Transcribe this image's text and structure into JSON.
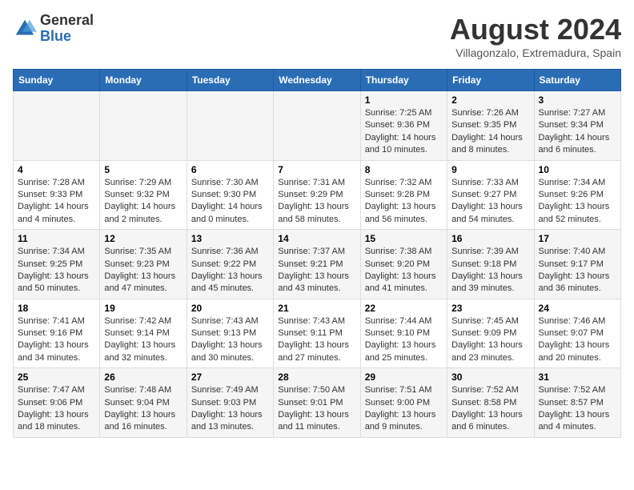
{
  "logo": {
    "general": "General",
    "blue": "Blue"
  },
  "title": "August 2024",
  "subtitle": "Villagonzalo, Extremadura, Spain",
  "days_of_week": [
    "Sunday",
    "Monday",
    "Tuesday",
    "Wednesday",
    "Thursday",
    "Friday",
    "Saturday"
  ],
  "weeks": [
    [
      {
        "day": "",
        "info": ""
      },
      {
        "day": "",
        "info": ""
      },
      {
        "day": "",
        "info": ""
      },
      {
        "day": "",
        "info": ""
      },
      {
        "day": "1",
        "info": "Sunrise: 7:25 AM\nSunset: 9:36 PM\nDaylight: 14 hours\nand 10 minutes."
      },
      {
        "day": "2",
        "info": "Sunrise: 7:26 AM\nSunset: 9:35 PM\nDaylight: 14 hours\nand 8 minutes."
      },
      {
        "day": "3",
        "info": "Sunrise: 7:27 AM\nSunset: 9:34 PM\nDaylight: 14 hours\nand 6 minutes."
      }
    ],
    [
      {
        "day": "4",
        "info": "Sunrise: 7:28 AM\nSunset: 9:33 PM\nDaylight: 14 hours\nand 4 minutes."
      },
      {
        "day": "5",
        "info": "Sunrise: 7:29 AM\nSunset: 9:32 PM\nDaylight: 14 hours\nand 2 minutes."
      },
      {
        "day": "6",
        "info": "Sunrise: 7:30 AM\nSunset: 9:30 PM\nDaylight: 14 hours\nand 0 minutes."
      },
      {
        "day": "7",
        "info": "Sunrise: 7:31 AM\nSunset: 9:29 PM\nDaylight: 13 hours\nand 58 minutes."
      },
      {
        "day": "8",
        "info": "Sunrise: 7:32 AM\nSunset: 9:28 PM\nDaylight: 13 hours\nand 56 minutes."
      },
      {
        "day": "9",
        "info": "Sunrise: 7:33 AM\nSunset: 9:27 PM\nDaylight: 13 hours\nand 54 minutes."
      },
      {
        "day": "10",
        "info": "Sunrise: 7:34 AM\nSunset: 9:26 PM\nDaylight: 13 hours\nand 52 minutes."
      }
    ],
    [
      {
        "day": "11",
        "info": "Sunrise: 7:34 AM\nSunset: 9:25 PM\nDaylight: 13 hours\nand 50 minutes."
      },
      {
        "day": "12",
        "info": "Sunrise: 7:35 AM\nSunset: 9:23 PM\nDaylight: 13 hours\nand 47 minutes."
      },
      {
        "day": "13",
        "info": "Sunrise: 7:36 AM\nSunset: 9:22 PM\nDaylight: 13 hours\nand 45 minutes."
      },
      {
        "day": "14",
        "info": "Sunrise: 7:37 AM\nSunset: 9:21 PM\nDaylight: 13 hours\nand 43 minutes."
      },
      {
        "day": "15",
        "info": "Sunrise: 7:38 AM\nSunset: 9:20 PM\nDaylight: 13 hours\nand 41 minutes."
      },
      {
        "day": "16",
        "info": "Sunrise: 7:39 AM\nSunset: 9:18 PM\nDaylight: 13 hours\nand 39 minutes."
      },
      {
        "day": "17",
        "info": "Sunrise: 7:40 AM\nSunset: 9:17 PM\nDaylight: 13 hours\nand 36 minutes."
      }
    ],
    [
      {
        "day": "18",
        "info": "Sunrise: 7:41 AM\nSunset: 9:16 PM\nDaylight: 13 hours\nand 34 minutes."
      },
      {
        "day": "19",
        "info": "Sunrise: 7:42 AM\nSunset: 9:14 PM\nDaylight: 13 hours\nand 32 minutes."
      },
      {
        "day": "20",
        "info": "Sunrise: 7:43 AM\nSunset: 9:13 PM\nDaylight: 13 hours\nand 30 minutes."
      },
      {
        "day": "21",
        "info": "Sunrise: 7:43 AM\nSunset: 9:11 PM\nDaylight: 13 hours\nand 27 minutes."
      },
      {
        "day": "22",
        "info": "Sunrise: 7:44 AM\nSunset: 9:10 PM\nDaylight: 13 hours\nand 25 minutes."
      },
      {
        "day": "23",
        "info": "Sunrise: 7:45 AM\nSunset: 9:09 PM\nDaylight: 13 hours\nand 23 minutes."
      },
      {
        "day": "24",
        "info": "Sunrise: 7:46 AM\nSunset: 9:07 PM\nDaylight: 13 hours\nand 20 minutes."
      }
    ],
    [
      {
        "day": "25",
        "info": "Sunrise: 7:47 AM\nSunset: 9:06 PM\nDaylight: 13 hours\nand 18 minutes."
      },
      {
        "day": "26",
        "info": "Sunrise: 7:48 AM\nSunset: 9:04 PM\nDaylight: 13 hours\nand 16 minutes."
      },
      {
        "day": "27",
        "info": "Sunrise: 7:49 AM\nSunset: 9:03 PM\nDaylight: 13 hours\nand 13 minutes."
      },
      {
        "day": "28",
        "info": "Sunrise: 7:50 AM\nSunset: 9:01 PM\nDaylight: 13 hours\nand 11 minutes."
      },
      {
        "day": "29",
        "info": "Sunrise: 7:51 AM\nSunset: 9:00 PM\nDaylight: 13 hours\nand 9 minutes."
      },
      {
        "day": "30",
        "info": "Sunrise: 7:52 AM\nSunset: 8:58 PM\nDaylight: 13 hours\nand 6 minutes."
      },
      {
        "day": "31",
        "info": "Sunrise: 7:52 AM\nSunset: 8:57 PM\nDaylight: 13 hours\nand 4 minutes."
      }
    ]
  ]
}
